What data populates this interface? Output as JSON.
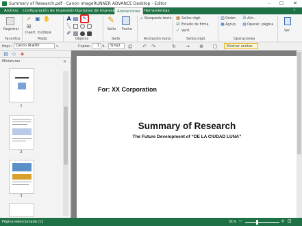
{
  "window": {
    "title": "Summary of Research.pdf - Canon imageRUNNER ADVANCE Desktop - Editor"
  },
  "tabs": [
    {
      "label": "Archivo"
    },
    {
      "label": "Configuración de impresión"
    },
    {
      "label": "Opciones de impresión"
    },
    {
      "label": "Anotaciones"
    },
    {
      "label": "Herramientas"
    }
  ],
  "ribbon": {
    "registrar": "Registrar",
    "insert_multiple": "Insert. múltiple",
    "sello": "Sello",
    "fecha": "Fecha",
    "busqueda_texto": "Búsqueda texto",
    "sellos_digit": "Sellos digit.",
    "estado_firma": "Estado de firma",
    "verif": "Verif.",
    "orden": "Orden",
    "agrup": "Agrup.",
    "alin": "Alin.",
    "operac_pagina": "Operac. página",
    "ver": "Ver",
    "groups": {
      "favoritos": "Favoritos",
      "modo": "Modo",
      "objetos": "Objetos",
      "sello": "Sello",
      "anotacion_texto": "Anotación texto",
      "sellos_digit": "Sellos digit.",
      "operaciones": "Operaciones"
    }
  },
  "toolbar": {
    "printer_label": "Impr.:",
    "printer_value": "Canon iR-ADV",
    "copies_label": "Copias:",
    "copies_value": "1",
    "print_mode": "Simpl.",
    "mostrar_anotac": "Mostrar anotac."
  },
  "sidebar": {
    "title": "Miniaturas",
    "thumbnails": [
      {
        "num": "1"
      },
      {
        "num": "2"
      },
      {
        "num": "3"
      }
    ]
  },
  "document": {
    "for_line": "For: XX Corporation",
    "title": "Summary of Research",
    "subtitle": "The Future Development of “DE LA CIUDAD LUNA”"
  },
  "status": {
    "page_info": "Página seleccionada /11",
    "zoom": "31%"
  },
  "colors": {
    "accent": "#1e7145",
    "highlight": "#e02020"
  }
}
